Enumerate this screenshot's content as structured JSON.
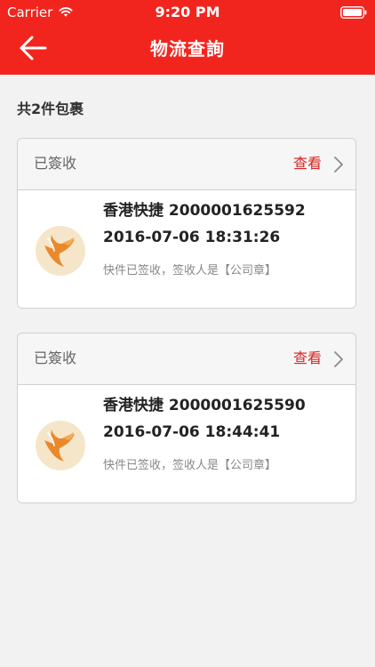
{
  "status_bar": {
    "carrier": "Carrier",
    "time": "9:20 PM",
    "icons": [
      "wifi-icon",
      "battery-icon"
    ]
  },
  "header": {
    "title": "物流查詢",
    "back_icon": "back-arrow-icon",
    "background_color": "#f2251e"
  },
  "summary": {
    "text": "共2件包裹"
  },
  "packages": [
    {
      "status": "已簽收",
      "view_label": "查看",
      "courier_logo": "courier-logo",
      "courier_name": "香港快捷",
      "tracking_number": "2000001625592",
      "tracking_line": "香港快捷 2000001625592",
      "datetime": "2016-07-06 18:31:26",
      "note": "快件已签收，签收人是【公司章】"
    },
    {
      "status": "已簽收",
      "view_label": "查看",
      "courier_logo": "courier-logo",
      "courier_name": "香港快捷",
      "tracking_number": "2000001625590",
      "tracking_line": "香港快捷 2000001625590",
      "datetime": "2016-07-06 18:44:41",
      "note": "快件已签收，签收人是【公司章】"
    }
  ],
  "colors": {
    "accent_red": "#d82323",
    "page_background": "#f2f2f2",
    "logo_background": "#f6e6c9",
    "logo_orange": "#e9892d"
  }
}
